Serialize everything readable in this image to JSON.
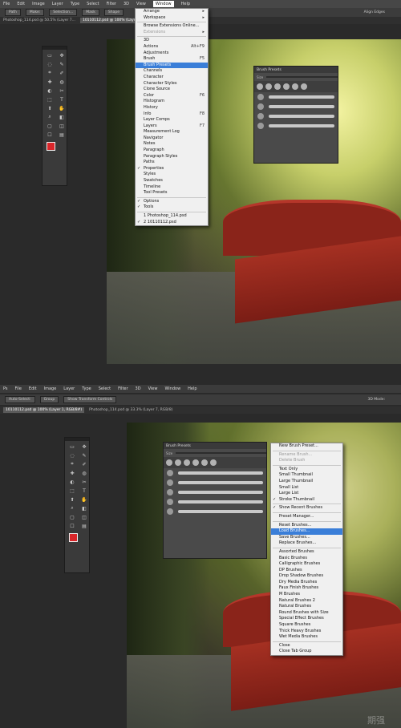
{
  "top": {
    "menubar": [
      "File",
      "Edit",
      "Image",
      "Layer",
      "Type",
      "Select",
      "Filter",
      "3D",
      "View",
      "Window",
      "Help"
    ],
    "active_menu": "Window",
    "options": [
      "Path",
      "Make:",
      "Selection...",
      "Mask",
      "Shape"
    ],
    "options_right": "Align Edges",
    "tabs": [
      "Photoshop_114.psd @ 50.5% (Layer 7...",
      "10110112.psd @ 100% (Layer 1..."
    ],
    "panel_title": "Brush Presets",
    "panel_size_label": "Size",
    "window_menu": [
      {
        "label": "Arrange",
        "sub": true
      },
      {
        "label": "Workspace",
        "sub": true
      },
      {
        "sep": true
      },
      {
        "label": "Browse Extensions Online..."
      },
      {
        "label": "Extensions",
        "dis": true,
        "sub": true
      },
      {
        "sep": true
      },
      {
        "label": "3D"
      },
      {
        "label": "Actions",
        "sc": "Alt+F9"
      },
      {
        "label": "Adjustments"
      },
      {
        "label": "Brush",
        "sc": "F5"
      },
      {
        "label": "Brush Presets",
        "hl": true
      },
      {
        "label": "Channels"
      },
      {
        "label": "Character"
      },
      {
        "label": "Character Styles"
      },
      {
        "label": "Clone Source"
      },
      {
        "label": "Color",
        "sc": "F6"
      },
      {
        "label": "Histogram"
      },
      {
        "label": "History"
      },
      {
        "label": "Info",
        "sc": "F8"
      },
      {
        "label": "Layer Comps"
      },
      {
        "label": "Layers",
        "sc": "F7"
      },
      {
        "label": "Measurement Log"
      },
      {
        "label": "Navigator"
      },
      {
        "label": "Notes"
      },
      {
        "label": "Paragraph"
      },
      {
        "label": "Paragraph Styles"
      },
      {
        "label": "Paths"
      },
      {
        "label": "Properties",
        "chk": true
      },
      {
        "label": "Styles"
      },
      {
        "label": "Swatches"
      },
      {
        "label": "Timeline"
      },
      {
        "label": "Tool Presets"
      },
      {
        "sep": true
      },
      {
        "label": "Options",
        "chk": true
      },
      {
        "label": "Tools",
        "chk": true
      },
      {
        "sep": true
      },
      {
        "label": "1 Photoshop_114.psd"
      },
      {
        "label": "2 10110112.psd",
        "chk": true
      }
    ]
  },
  "bottom": {
    "menubar": [
      "Ps",
      "File",
      "Edit",
      "Image",
      "Layer",
      "Type",
      "Select",
      "Filter",
      "3D",
      "View",
      "Window",
      "Help"
    ],
    "options": [
      "Auto-Select:",
      "Group",
      "Show Transform Controls"
    ],
    "options_right": "3D Mode:",
    "tabs": [
      "10110112.psd @ 100% (Layer 1, RGB/8#)",
      "Photoshop_114.psd @ 33.3% (Layer 7, RGB/8)"
    ],
    "panel_title": "Brush Presets",
    "panel_size_label": "Size",
    "flyout_menu": [
      {
        "label": "New Brush Preset..."
      },
      {
        "sep": true
      },
      {
        "label": "Rename Brush...",
        "dis": true
      },
      {
        "label": "Delete Brush",
        "dis": true
      },
      {
        "sep": true
      },
      {
        "label": "Text Only"
      },
      {
        "label": "Small Thumbnail"
      },
      {
        "label": "Large Thumbnail"
      },
      {
        "label": "Small List"
      },
      {
        "label": "Large List"
      },
      {
        "label": "Stroke Thumbnail",
        "chk": true
      },
      {
        "sep": true
      },
      {
        "label": "Show Recent Brushes",
        "chk": true
      },
      {
        "sep": true
      },
      {
        "label": "Preset Manager..."
      },
      {
        "sep": true
      },
      {
        "label": "Reset Brushes..."
      },
      {
        "label": "Load Brushes...",
        "hl": true
      },
      {
        "label": "Save Brushes..."
      },
      {
        "label": "Replace Brushes..."
      },
      {
        "sep": true
      },
      {
        "label": "Assorted Brushes"
      },
      {
        "label": "Basic Brushes"
      },
      {
        "label": "Calligraphic Brushes"
      },
      {
        "label": "DP Brushes"
      },
      {
        "label": "Drop Shadow Brushes"
      },
      {
        "label": "Dry Media Brushes"
      },
      {
        "label": "Faux Finish Brushes"
      },
      {
        "label": "M Brushes"
      },
      {
        "label": "Natural Brushes 2"
      },
      {
        "label": "Natural Brushes"
      },
      {
        "label": "Round Brushes with Size"
      },
      {
        "label": "Special Effect Brushes"
      },
      {
        "label": "Square Brushes"
      },
      {
        "label": "Thick Heavy Brushes"
      },
      {
        "label": "Wet Media Brushes"
      },
      {
        "sep": true
      },
      {
        "label": "Close"
      },
      {
        "label": "Close Tab Group"
      }
    ]
  },
  "watermark": "期强",
  "colors": {
    "foreground": "#d9262a",
    "background": "#000000",
    "highlight": "#3a7ed8"
  }
}
